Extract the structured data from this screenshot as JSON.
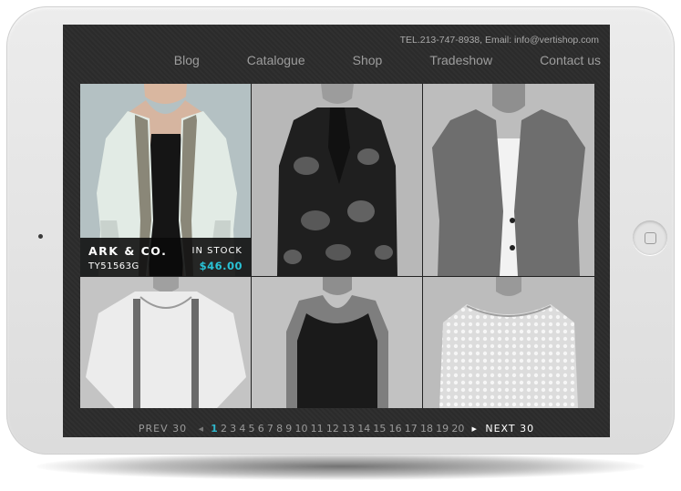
{
  "header": {
    "contact": "TEL.213-747-8938, Email: info@vertishop.com",
    "nav": [
      "Blog",
      "Catalogue",
      "Shop",
      "Tradeshow",
      "Contact us"
    ]
  },
  "featured": {
    "brand": "ARK & CO.",
    "stock": "IN STOCK",
    "sku": "TY51563G",
    "price": "$46.00"
  },
  "pagination": {
    "prev": "PREV 30",
    "next": "NEXT 30",
    "pages": [
      "1",
      "2",
      "3",
      "4",
      "5",
      "6",
      "7",
      "8",
      "9",
      "10",
      "11",
      "12",
      "13",
      "14",
      "15",
      "16",
      "17",
      "18",
      "19",
      "20"
    ],
    "active": "1"
  },
  "colors": {
    "accent": "#29c3d6",
    "screen_bg": "#2b2b2b"
  },
  "icons": {
    "prev": "arrow-left-icon",
    "next": "arrow-right-icon",
    "home": "home-button-icon"
  }
}
